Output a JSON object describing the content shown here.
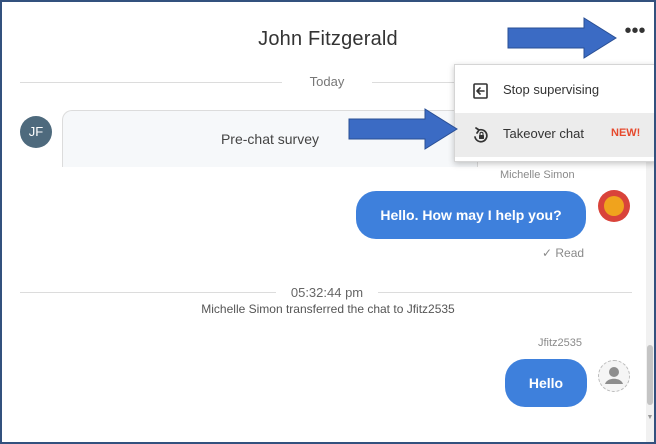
{
  "header": {
    "title": "John Fitzgerald",
    "more_icon": "more-horizontal-icon",
    "more_label": "•••"
  },
  "conversation": {
    "date_label": "Today",
    "prechat_avatar_initials": "JF",
    "prechat_survey_label": "Pre-chat survey",
    "agent_name": "Michelle Simon",
    "agent_message": "Hello. How may I help you?",
    "read_status": "✓ Read",
    "transfer_time": "05:32:44 pm",
    "transfer_text": "Michelle Simon transferred the chat to Jfitz2535",
    "supervisor_name": "Jfitz2535",
    "supervisor_message": "Hello"
  },
  "menu": {
    "items": [
      {
        "label": "Stop supervising",
        "icon": "exit-icon"
      },
      {
        "label": "Takeover chat",
        "icon": "takeover-icon",
        "badge": "NEW!"
      }
    ]
  },
  "colors": {
    "frame_border": "#33517e",
    "bubble": "#3e80dc",
    "arrow": "#3b6bc4",
    "badge": "#e64a2e",
    "avatar_jf": "#4e6a7d"
  }
}
